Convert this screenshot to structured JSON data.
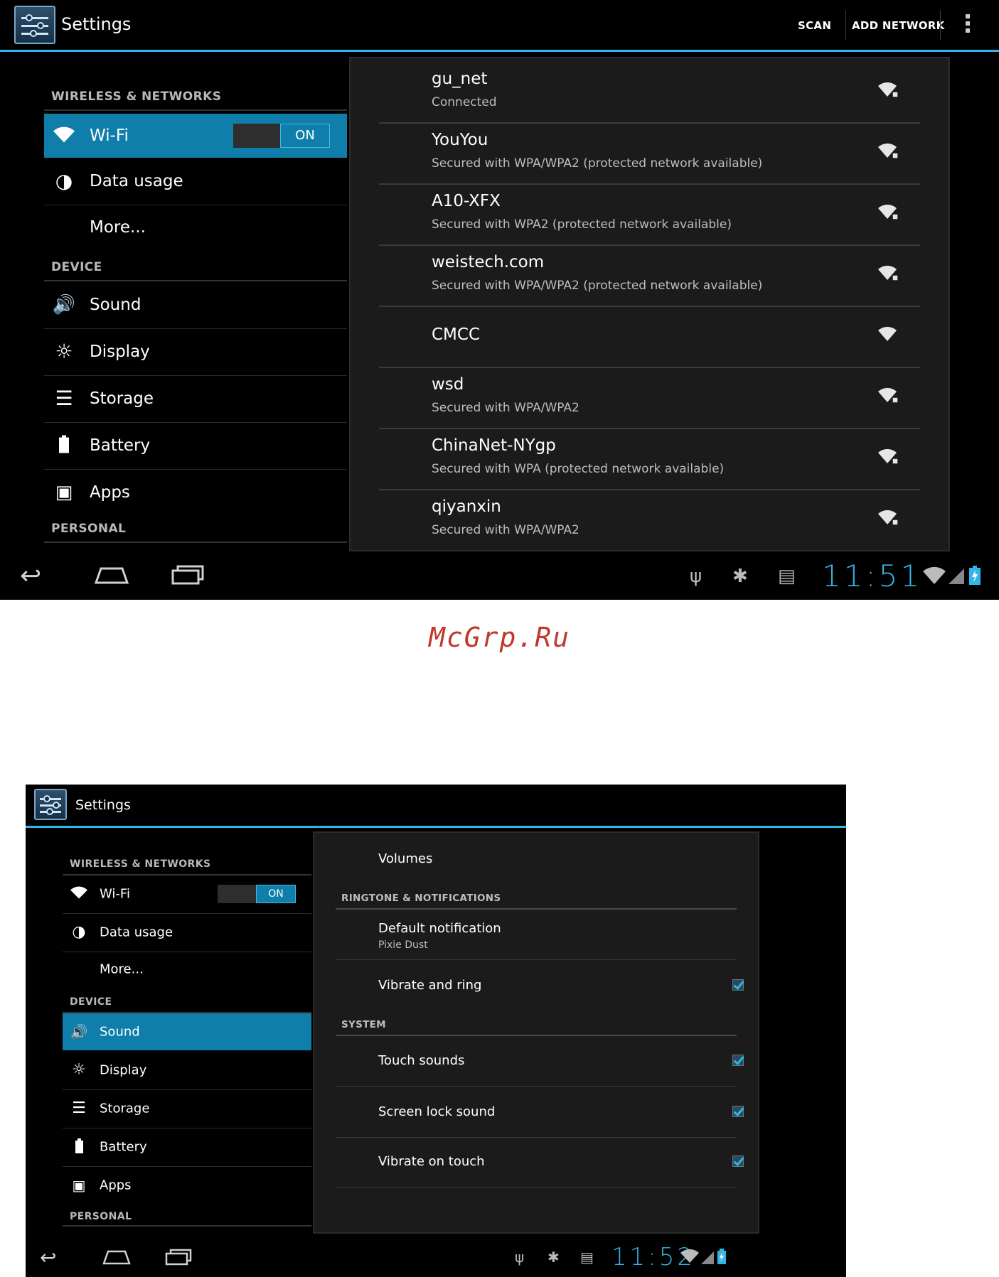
{
  "shot1": {
    "title": "Settings",
    "actions": {
      "scan": "SCAN",
      "add_network": "ADD NETWORK"
    },
    "sidebar": {
      "wireless_header": "WIRELESS & NETWORKS",
      "wifi": {
        "label": "Wi-Fi",
        "toggle": "ON"
      },
      "data_usage": "Data usage",
      "more": "More...",
      "device_header": "DEVICE",
      "sound": "Sound",
      "display": "Display",
      "storage": "Storage",
      "battery": "Battery",
      "apps": "Apps",
      "personal_header": "PERSONAL"
    },
    "networks": [
      {
        "ssid": "gu_net",
        "status": "Connected"
      },
      {
        "ssid": "YouYou",
        "status": "Secured with WPA/WPA2 (protected network available)"
      },
      {
        "ssid": "A10-XFX",
        "status": "Secured with WPA2 (protected network available)"
      },
      {
        "ssid": "weistech.com",
        "status": "Secured with WPA/WPA2 (protected network available)"
      },
      {
        "ssid": "CMCC",
        "status": ""
      },
      {
        "ssid": "wsd",
        "status": "Secured with WPA/WPA2"
      },
      {
        "ssid": "ChinaNet-NYgp",
        "status": "Secured with WPA (protected network available)"
      },
      {
        "ssid": "qiyanxin",
        "status": "Secured with WPA/WPA2"
      }
    ],
    "clock": "11:51"
  },
  "watermark": "McGrp.Ru",
  "shot2": {
    "title": "Settings",
    "sidebar": {
      "wireless_header": "WIRELESS & NETWORKS",
      "wifi": {
        "label": "Wi-Fi",
        "toggle": "ON"
      },
      "data_usage": "Data usage",
      "more": "More...",
      "device_header": "DEVICE",
      "sound": "Sound",
      "display": "Display",
      "storage": "Storage",
      "battery": "Battery",
      "apps": "Apps",
      "personal_header": "PERSONAL"
    },
    "panel": {
      "volumes": "Volumes",
      "ringtone_header": "RINGTONE & NOTIFICATIONS",
      "default_notification": "Default notification",
      "default_notification_value": "Pixie Dust",
      "vibrate_ring": "Vibrate and ring",
      "system_header": "SYSTEM",
      "touch_sounds": "Touch sounds",
      "screen_lock_sound": "Screen lock sound",
      "vibrate_touch": "Vibrate on touch"
    },
    "clock": "11:52"
  },
  "colors": {
    "accent": "#33b5e5",
    "selected": "#0f7eaa",
    "watermark": "#c0392b"
  }
}
